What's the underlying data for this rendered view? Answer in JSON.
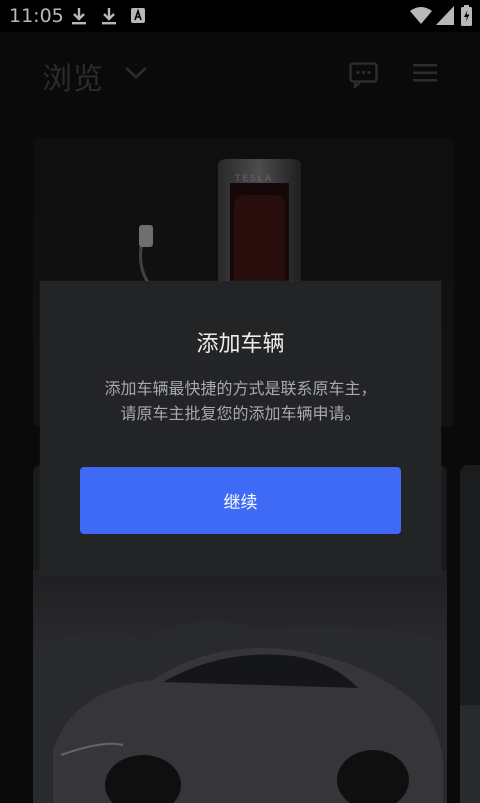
{
  "status_bar": {
    "time": "11:05",
    "left_icons": [
      "download-icon",
      "download-icon",
      "keyboard-a-icon"
    ],
    "right_icons": [
      "wifi-icon",
      "signal-icon",
      "battery-charging-icon"
    ]
  },
  "header": {
    "title": "浏览",
    "icons": [
      "chevron-down-icon",
      "chat-icon",
      "menu-icon"
    ]
  },
  "background": {
    "charger_brand": "TESLA"
  },
  "dialog": {
    "title": "添加车辆",
    "message_line1": "添加车辆最快捷的方式是联系原车主，",
    "message_line2": "请原车主批复您的添加车辆申请。",
    "continue_label": "继续"
  },
  "colors": {
    "accent": "#3e6af6",
    "dialog_bg": "#232426",
    "page_bg": "#0e0e0f"
  }
}
